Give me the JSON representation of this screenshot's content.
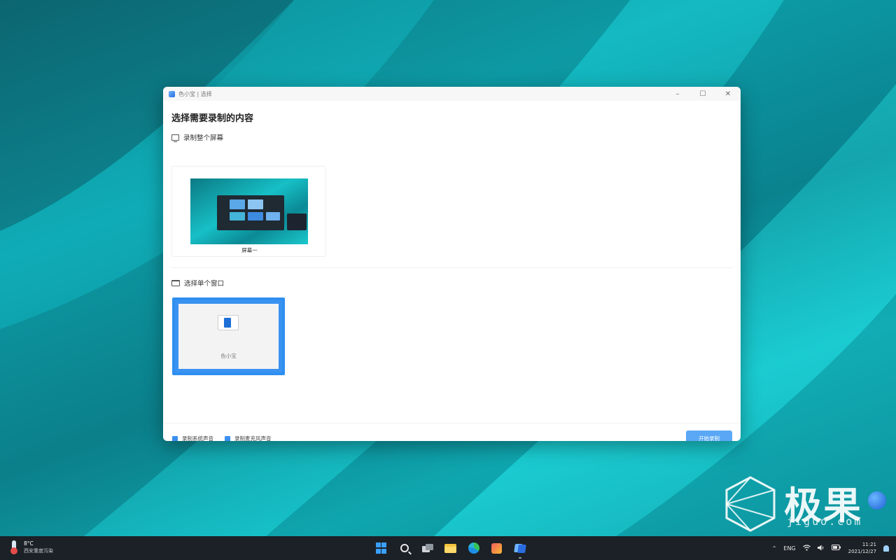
{
  "window": {
    "title": "色小宝 | 选择",
    "minimize_label": "–",
    "maximize_label": "☐",
    "close_label": "✕"
  },
  "dialog": {
    "heading": "选择需要录制的内容",
    "section_screen": "录制整个屏幕",
    "screen_option_label": "屏幕一",
    "section_window": "选择单个窗口",
    "window_option_label": "色小宝",
    "checkbox_system_audio": "录制系统声音",
    "checkbox_mic_audio": "录制麦克风声音",
    "start_button": "开始录制"
  },
  "taskbar": {
    "weather_temp": "8°C",
    "weather_desc": "西安重度污染",
    "tray_language": "ENG",
    "tray_wifi": "",
    "tray_volume": "",
    "tray_battery": "",
    "clock_time": "11:21",
    "clock_date": "2021/12/27",
    "icons": [
      "start-icon",
      "search-icon",
      "task-view-icon",
      "file-explorer-icon",
      "edge-icon",
      "store-icon",
      "recorder-app-icon"
    ]
  },
  "watermark": {
    "brand": "极果",
    "site": "jiguo.com"
  },
  "colors": {
    "accent": "#2f8ff0",
    "button": "#5aa8f5",
    "taskbar": "#1b2126"
  }
}
